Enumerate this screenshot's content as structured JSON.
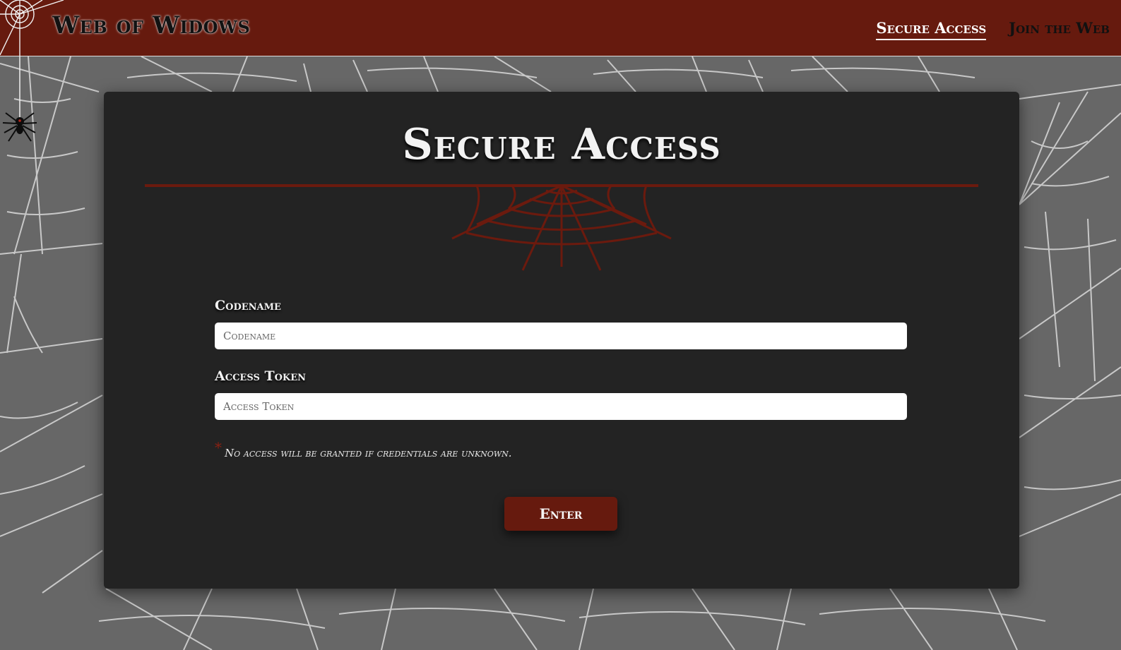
{
  "header": {
    "brand": "Web of Widows",
    "nav": [
      {
        "label": "Secure Access",
        "active": true
      },
      {
        "label": "Join the Web",
        "active": false
      }
    ]
  },
  "card": {
    "title": "Secure Access",
    "fields": [
      {
        "label": "Codename",
        "placeholder": "Codename",
        "value": ""
      },
      {
        "label": "Access Token",
        "placeholder": "Access Token",
        "value": ""
      }
    ],
    "note_marker": "*",
    "note": "No access will be granted if credentials are unknown.",
    "submit_label": "Enter"
  },
  "colors": {
    "header_bg": "#661a0e",
    "card_bg": "#232323",
    "page_bg": "#676767",
    "accent": "#661a0e",
    "web_lines": "#e6e6e6"
  },
  "icons": [
    "corner-web-icon",
    "spider-icon",
    "web-divider-icon"
  ]
}
